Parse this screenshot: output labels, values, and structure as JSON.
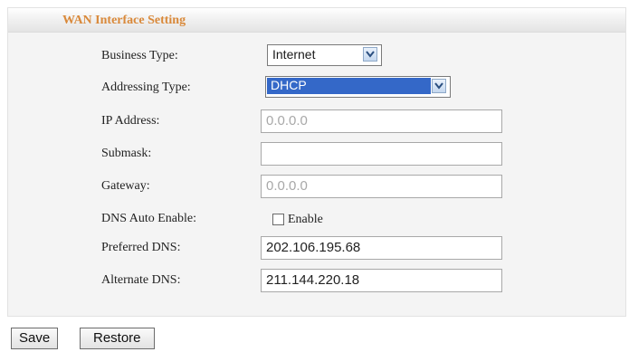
{
  "section_title": "WAN Interface Setting",
  "fields": {
    "business_type": {
      "label": "Business Type:",
      "value": "Internet"
    },
    "addressing_type": {
      "label": "Addressing Type:",
      "value": "DHCP"
    },
    "ip_address": {
      "label": "IP Address:",
      "value": "0.0.0.0"
    },
    "submask": {
      "label": "Submask:",
      "value": ""
    },
    "gateway": {
      "label": "Gateway:",
      "value": "0.0.0.0"
    },
    "dns_auto": {
      "label": "DNS Auto Enable:",
      "checkbox_label": "Enable",
      "checked": false
    },
    "preferred_dns": {
      "label": "Preferred DNS:",
      "value": "202.106.195.68"
    },
    "alternate_dns": {
      "label": "Alternate DNS:",
      "value": "211.144.220.18"
    }
  },
  "buttons": {
    "save": "Save",
    "restore": "Restore"
  },
  "colors": {
    "title": "#d9893a",
    "selection": "#3468c8"
  }
}
